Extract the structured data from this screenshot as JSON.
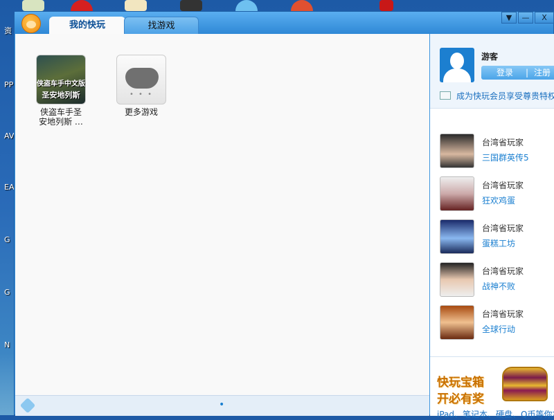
{
  "desktop": {
    "labels": [
      "资",
      "PP",
      "AV",
      "EA",
      "G",
      "G",
      "N"
    ]
  },
  "window": {
    "tabs": [
      {
        "label": "我的快玩",
        "active": true
      },
      {
        "label": "找游戏",
        "active": false
      }
    ],
    "controls": {
      "menu": "▼",
      "minimize": "—",
      "close": "X"
    }
  },
  "games": [
    {
      "title": "侠盗车手圣安地列斯 ...",
      "line1": "侠盗车手圣",
      "line2": "安地列斯 …",
      "icon_text1": "侠盗车手中文版",
      "icon_text2": "圣安地列斯"
    },
    {
      "title": "更多游戏",
      "line1": "更多游戏",
      "dots": "• • •"
    }
  ],
  "status": {
    "page_dot": "•"
  },
  "user": {
    "name": "游客",
    "login": "登录",
    "separator": "|",
    "register": "注册",
    "vip_text": "成为快玩会员享受尊贵特权"
  },
  "players": [
    {
      "name": "台湾省玩家",
      "game": "三国群英传5"
    },
    {
      "name": "台湾省玩家",
      "game": "狂欢鸡蛋"
    },
    {
      "name": "台湾省玩家",
      "game": "蛋糕工坊"
    },
    {
      "name": "台湾省玩家",
      "game": "战神不败"
    },
    {
      "name": "台湾省玩家",
      "game": "全球行动"
    }
  ],
  "banner": {
    "line1": "快玩宝箱",
    "line2": "开必有奖",
    "sub": "iPad、笔记本、硬盘、Q币等你拿"
  }
}
